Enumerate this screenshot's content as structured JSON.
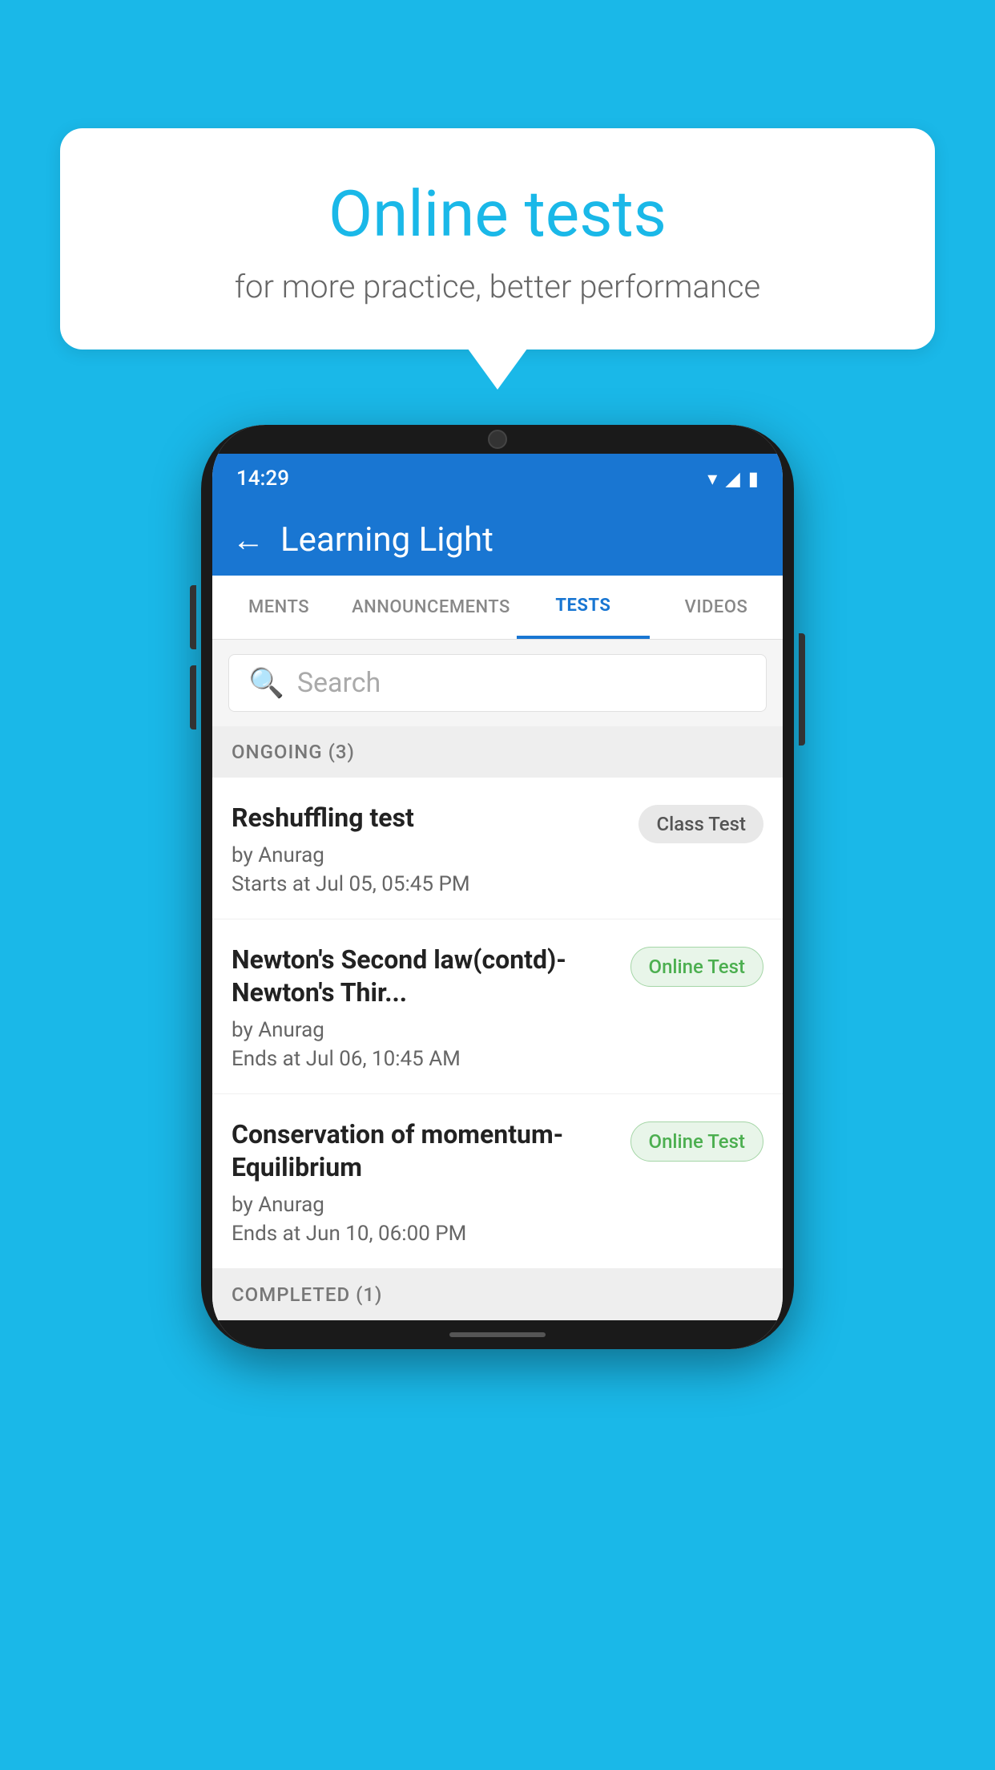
{
  "background_color": "#1ab8e8",
  "speech_bubble": {
    "title": "Online tests",
    "subtitle": "for more practice, better performance"
  },
  "phone": {
    "status_bar": {
      "time": "14:29",
      "icons": [
        "wifi",
        "signal",
        "battery"
      ]
    },
    "app_bar": {
      "title": "Learning Light",
      "back_label": "←"
    },
    "tabs": [
      {
        "label": "MENTS",
        "active": false
      },
      {
        "label": "ANNOUNCEMENTS",
        "active": false
      },
      {
        "label": "TESTS",
        "active": true
      },
      {
        "label": "VIDEOS",
        "active": false
      }
    ],
    "search": {
      "placeholder": "Search"
    },
    "sections": [
      {
        "header": "ONGOING (3)",
        "items": [
          {
            "name": "Reshuffling test",
            "author": "by Anurag",
            "time_label": "Starts at",
            "time": "Jul 05, 05:45 PM",
            "badge": "Class Test",
            "badge_type": "class"
          },
          {
            "name": "Newton's Second law(contd)-Newton's Thir...",
            "author": "by Anurag",
            "time_label": "Ends at",
            "time": "Jul 06, 10:45 AM",
            "badge": "Online Test",
            "badge_type": "online"
          },
          {
            "name": "Conservation of momentum-Equilibrium",
            "author": "by Anurag",
            "time_label": "Ends at",
            "time": "Jun 10, 06:00 PM",
            "badge": "Online Test",
            "badge_type": "online"
          }
        ]
      }
    ],
    "completed_section": {
      "header": "COMPLETED (1)"
    }
  }
}
